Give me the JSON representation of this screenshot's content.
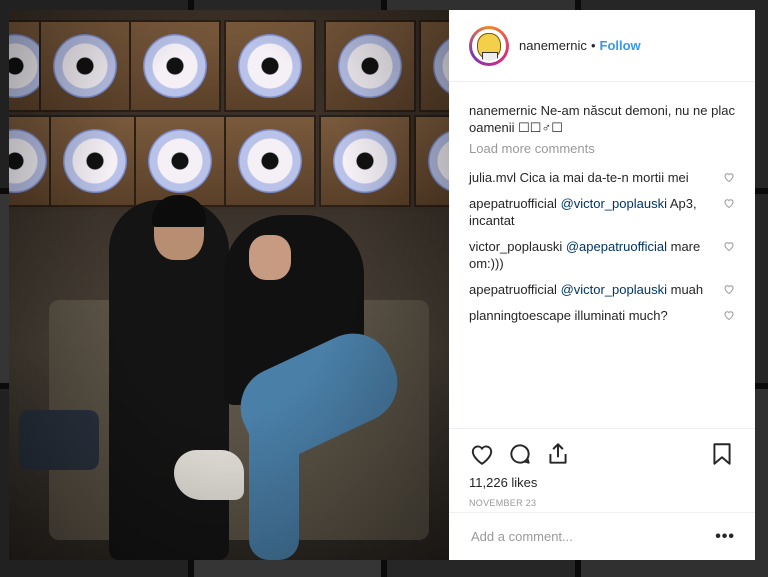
{
  "post": {
    "username": "nanemernic",
    "separator": "•",
    "follow_label": "Follow",
    "caption_user": "nanemernic",
    "caption_text": "Ne-am născut demoni, nu ne plac oamenii ☐☐♂☐",
    "load_more": "Load more comments",
    "comments": [
      {
        "user": "julia.mvl",
        "text": "Cica ia mai da-te-n mortii mei",
        "mention": ""
      },
      {
        "user": "apepatruofficial",
        "mention": "@victor_poplauski",
        "text": "Ap3, incantat"
      },
      {
        "user": "victor_poplauski",
        "mention": "@apepatruofficial",
        "text": "mare om:)))"
      },
      {
        "user": "apepatruofficial",
        "mention": "@victor_poplauski",
        "text": "muah"
      },
      {
        "user": "planningtoescape",
        "text": "illuminati much?",
        "mention": ""
      }
    ],
    "likes": "11,226 likes",
    "date": "NOVEMBER 23",
    "add_comment_placeholder": "Add a comment...",
    "more_options": "•••"
  },
  "icons": {
    "like": "heart-icon",
    "comment": "comment-icon",
    "share": "share-icon",
    "save": "bookmark-icon",
    "comment_like": "heart-icon"
  },
  "colors": {
    "link": "#3897f0",
    "mention": "#003569",
    "text": "#262626",
    "muted": "#999999"
  }
}
